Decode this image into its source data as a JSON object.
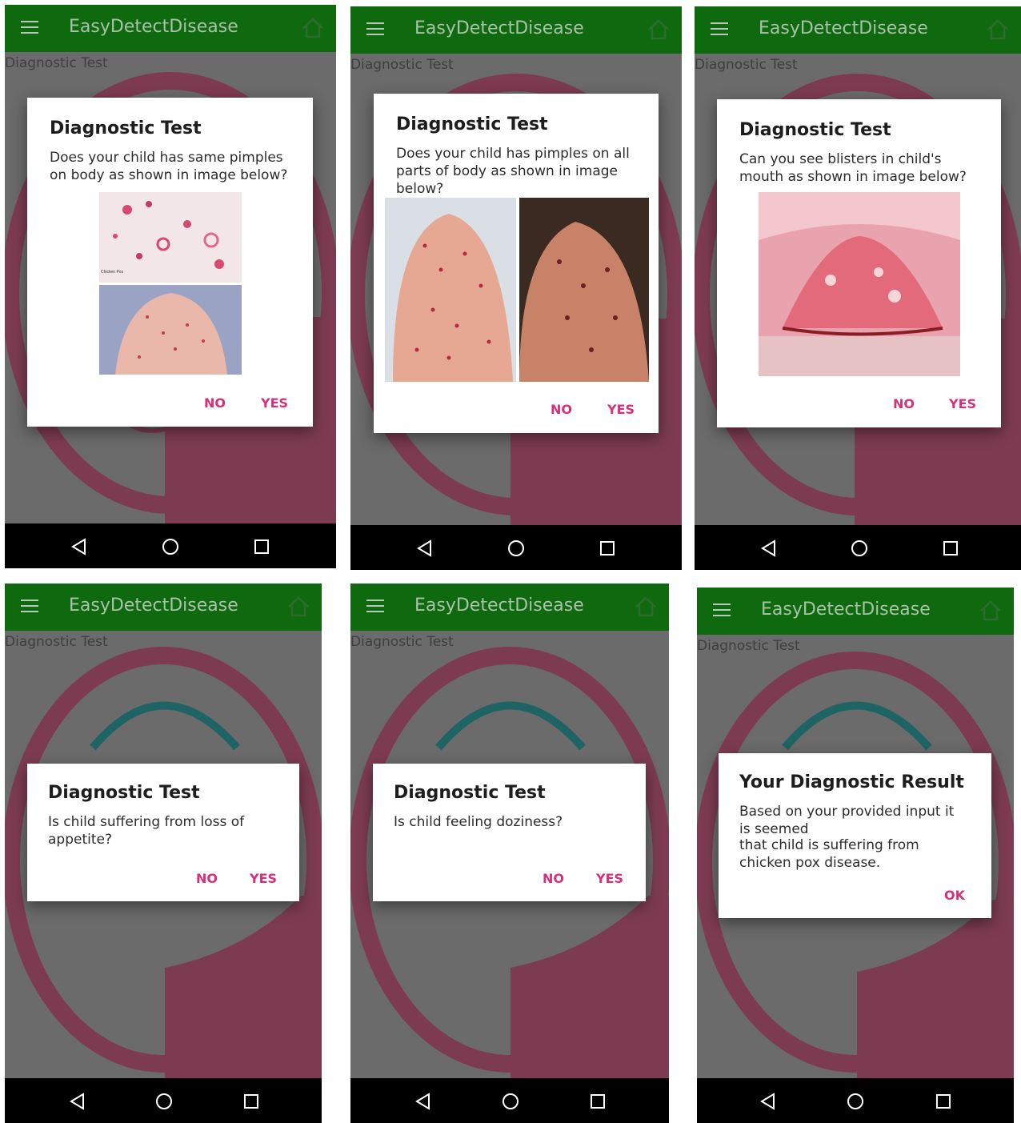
{
  "app": {
    "title": "EasyDetectDisease",
    "subtitle": "Diagnostic Test"
  },
  "colors": {
    "appbar": "#0f6a0f",
    "accent": "#d6307a",
    "logo_ring": "#b84d6e",
    "logo_arc": "#1d8c8c"
  },
  "icons": {
    "menu": "hamburger-menu-icon",
    "home": "home-icon",
    "back": "back-triangle-icon",
    "home_nav": "home-circle-icon",
    "recents": "recents-square-icon"
  },
  "screens": [
    {
      "dialog_title": "Diagnostic Test",
      "message": "Does your child has same pimples on body as shown in image below?",
      "no": "NO",
      "yes": "YES",
      "image_captions": [
        "Chicken Pox"
      ]
    },
    {
      "dialog_title": "Diagnostic Test",
      "message": "Does your child has pimples on all parts of body as shown in image below?",
      "no": "NO",
      "yes": "YES"
    },
    {
      "dialog_title": "Diagnostic Test",
      "message": "Can you see blisters in child's mouth as shown in image below?",
      "no": "NO",
      "yes": "YES"
    },
    {
      "dialog_title": "Diagnostic Test",
      "message": "Is child suffering from loss of appetite?",
      "no": "NO",
      "yes": "YES"
    },
    {
      "dialog_title": "Diagnostic Test",
      "message": "Is child feeling doziness?",
      "no": "NO",
      "yes": "YES"
    },
    {
      "dialog_title": "Your Diagnostic Result",
      "message_line1": "Based on your provided input it is seemed",
      "message_line2": "that child is suffering from chicken pox disease.",
      "ok": "OK"
    }
  ]
}
